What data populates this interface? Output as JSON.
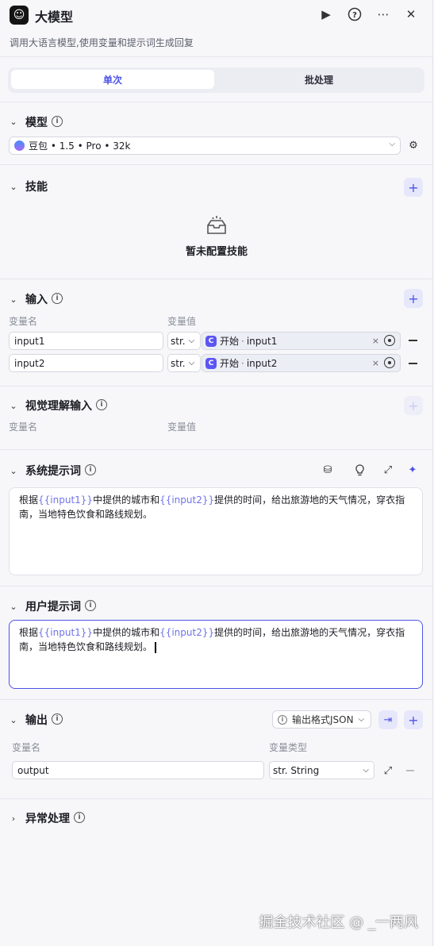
{
  "header": {
    "title": "大模型",
    "description": "调用大语言模型,使用变量和提示词生成回复"
  },
  "tabs": [
    {
      "label": "单次",
      "active": true
    },
    {
      "label": "批处理",
      "active": false
    }
  ],
  "model_section": {
    "title": "模型",
    "selected": "豆包 • 1.5 • Pro • 32k"
  },
  "skills_section": {
    "title": "技能",
    "empty_text": "暂未配置技能"
  },
  "input_section": {
    "title": "输入",
    "col_name": "变量名",
    "col_value": "变量值",
    "rows": [
      {
        "name": "input1",
        "type": "str.",
        "ref_node": "开始",
        "ref_var": "input1"
      },
      {
        "name": "input2",
        "type": "str.",
        "ref_node": "开始",
        "ref_var": "input2"
      }
    ]
  },
  "vision_section": {
    "title": "视觉理解输入",
    "col_name": "变量名",
    "col_value": "变量值"
  },
  "system_prompt": {
    "title": "系统提示词",
    "parts": [
      "根据",
      "{{input1}}",
      "中提供的城市和",
      "{{input2}}",
      "提供的时间，给出旅游地的天气情况，穿衣指南，当地特色饮食和路线规划。"
    ]
  },
  "user_prompt": {
    "title": "用户提示词",
    "parts": [
      "根据",
      "{{input1}}",
      "中提供的城市和",
      "{{input2}}",
      "提供的时间，给出旅游地的天气情况，穿衣指南，当地特色饮食和路线规划。"
    ]
  },
  "output_section": {
    "title": "输出",
    "format_label": "输出格式JSON",
    "col_name": "变量名",
    "col_type": "变量类型",
    "rows": [
      {
        "name": "output",
        "type": "str. String"
      }
    ]
  },
  "exception_section": {
    "title": "异常处理"
  },
  "watermark": "掘金技术社区 @ _一两风",
  "colors": {
    "accent": "#4d53e8",
    "variable": "#6f73ea",
    "background": "#f7f7fa"
  }
}
